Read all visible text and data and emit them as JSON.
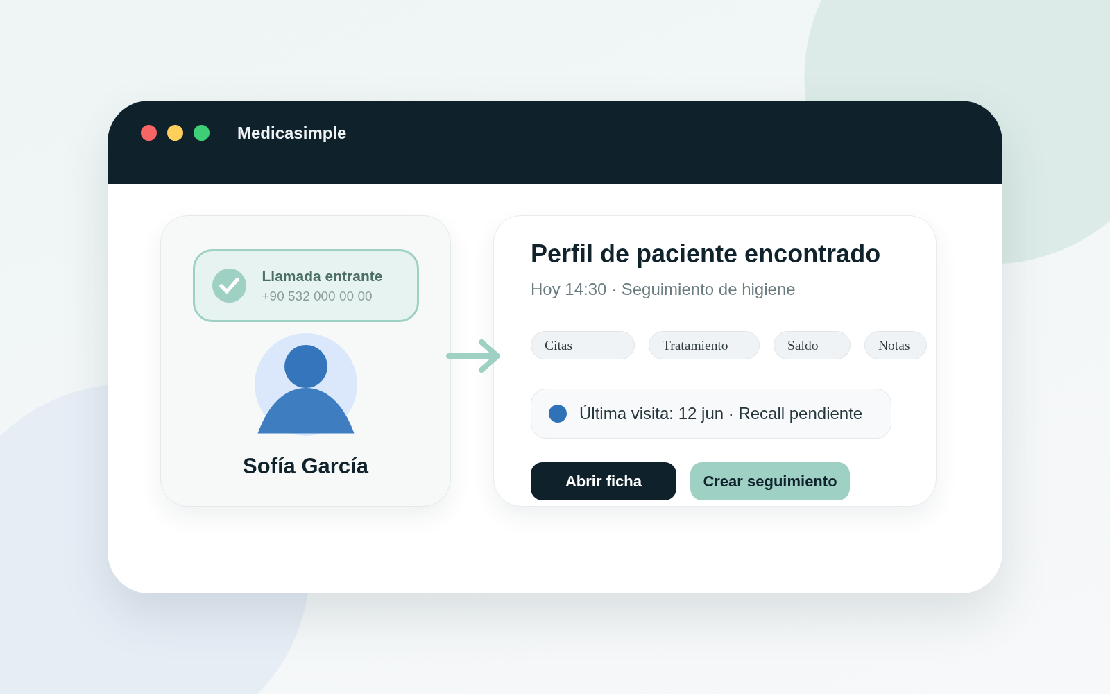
{
  "window": {
    "title": "Medicasimple",
    "controls": [
      {
        "color": "#f76565"
      },
      {
        "color": "#ffcf5c"
      },
      {
        "color": "#3ecf76"
      }
    ]
  },
  "caller": {
    "call_label": "Llamada entrante",
    "phone": "+90 532 000 00 00",
    "name": "Sofía García"
  },
  "profile": {
    "title": "Perfil de paciente encontrado",
    "subtitle": "Hoy 14:30 · Seguimiento de higiene",
    "chips": [
      "Citas",
      "Tratamiento",
      "Saldo",
      "Notas"
    ],
    "last_visit": "Última visita: 12 jun · Recall pendiente",
    "buttons": [
      {
        "label": "Abrir ficha",
        "kind": "primary"
      },
      {
        "label": "Crear seguimiento",
        "kind": "secondary"
      }
    ]
  }
}
